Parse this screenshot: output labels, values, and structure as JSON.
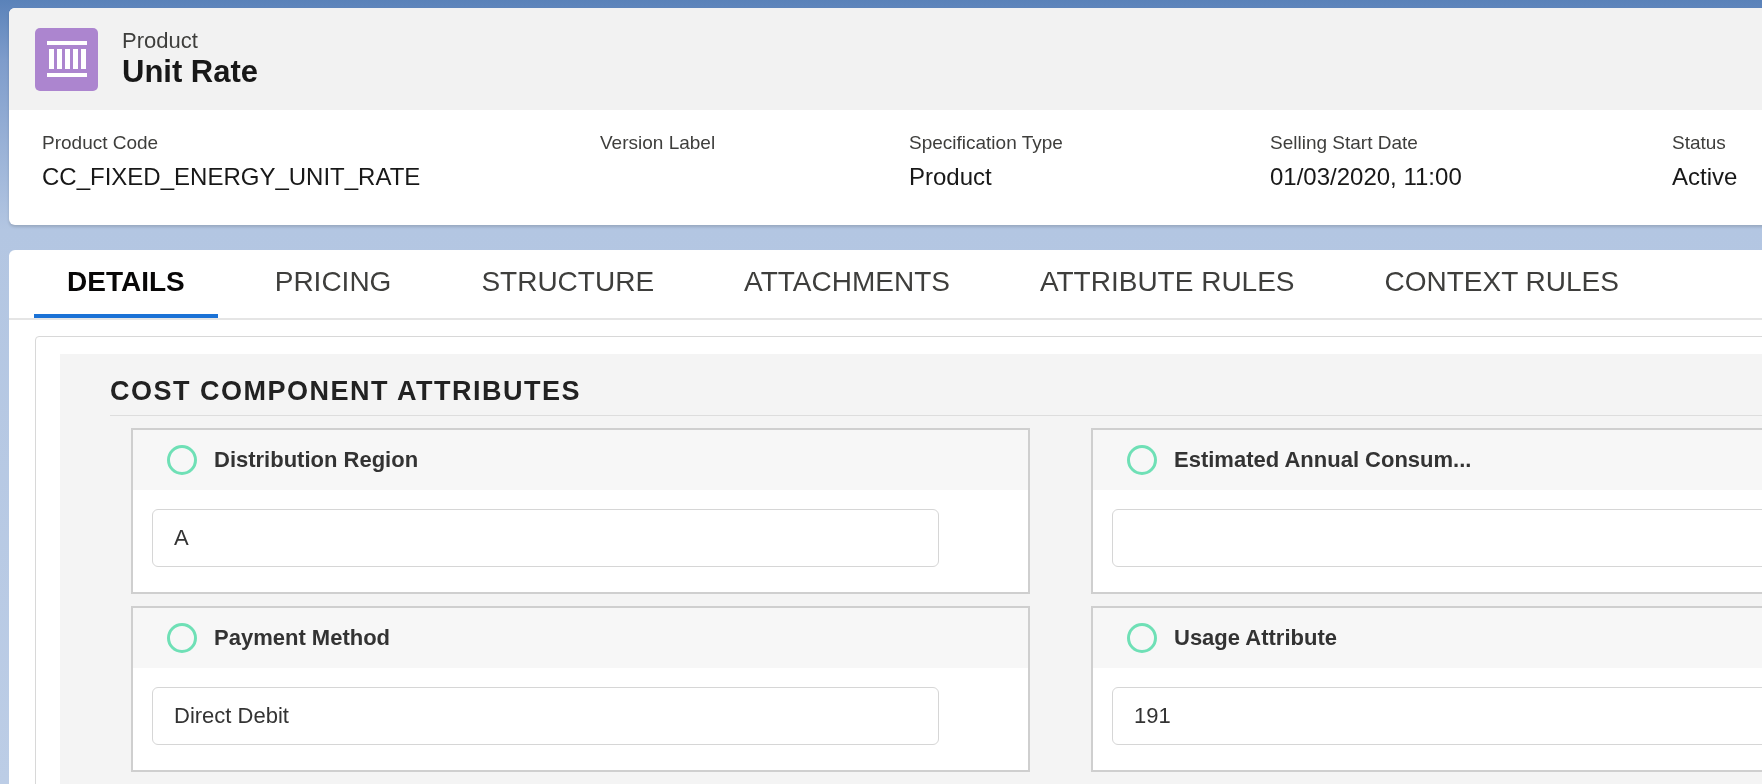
{
  "record": {
    "object_type": "Product",
    "title": "Unit Rate"
  },
  "fields": [
    {
      "label": "Product Code",
      "value": "CC_FIXED_ENERGY_UNIT_RATE"
    },
    {
      "label": "Version Label"
    },
    {
      "label": "Specification Type",
      "value": "Product"
    },
    {
      "label": "Selling Start Date",
      "value": "01/03/2020, 11:00"
    },
    {
      "label": "Status",
      "value": "Active"
    }
  ],
  "tabs": [
    {
      "label": "DETAILS",
      "selected": true
    },
    {
      "label": "PRICING",
      "selected": false
    },
    {
      "label": "STRUCTURE",
      "selected": false
    },
    {
      "label": "ATTACHMENTS",
      "selected": false
    },
    {
      "label": "ATTRIBUTE RULES",
      "selected": false
    },
    {
      "label": "CONTEXT RULES",
      "selected": false
    }
  ],
  "section": {
    "title": "COST COMPONENT ATTRIBUTES",
    "attributes": [
      {
        "label": "Distribution Region",
        "value": "A"
      },
      {
        "label": "Estimated Annual Consum..."
      },
      {
        "label": "Payment Method",
        "value": "Direct Debit"
      },
      {
        "label": "Usage Attribute",
        "value": "191"
      }
    ]
  }
}
